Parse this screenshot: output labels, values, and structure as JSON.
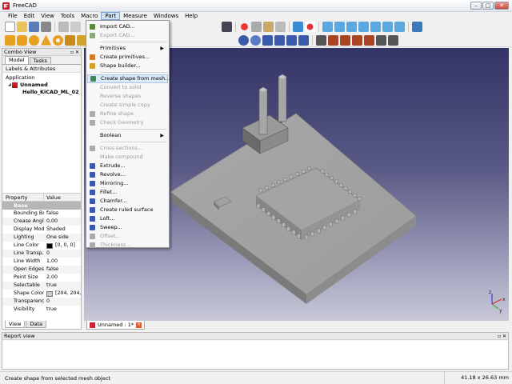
{
  "window": {
    "title": "FreeCAD",
    "min": "–",
    "max": "□",
    "close": "✕"
  },
  "menubar": [
    "File",
    "Edit",
    "View",
    "Tools",
    "Macro",
    "Part",
    "Measure",
    "Windows",
    "Help"
  ],
  "combo_view": {
    "title": "Combo View",
    "tabs": [
      "Model",
      "Tasks"
    ],
    "labels_header": "Labels & Attributes",
    "tree": {
      "root": "Application",
      "document": "Unnamed",
      "object": "Hello_KiCAD_ML_02"
    }
  },
  "property_table": {
    "headers": [
      "Property",
      "Value"
    ],
    "group": "Base",
    "rows": [
      {
        "name": "Bounding Box",
        "value": "false"
      },
      {
        "name": "Crease Angle",
        "value": "0,00"
      },
      {
        "name": "Display Mode",
        "value": "Shaded"
      },
      {
        "name": "Lighting",
        "value": "One side"
      },
      {
        "name": "Line Color",
        "value": "[0, 0, 0]",
        "swatch": "#000000"
      },
      {
        "name": "Line Transp...",
        "value": "0"
      },
      {
        "name": "Line Width",
        "value": "1,00"
      },
      {
        "name": "Open Edges",
        "value": "false"
      },
      {
        "name": "Point Size",
        "value": "2,00"
      },
      {
        "name": "Selectable",
        "value": "true"
      },
      {
        "name": "Shape Color",
        "value": "[204, 204, 2...",
        "swatch": "#cccccc"
      },
      {
        "name": "Transparency",
        "value": "0"
      },
      {
        "name": "Visibility",
        "value": "true"
      }
    ],
    "bottom_tabs": [
      "View",
      "Data"
    ]
  },
  "doc_tab": {
    "label": "Unnamed : 1*"
  },
  "report_view": {
    "title": "Report view"
  },
  "part_menu": [
    {
      "label": "Import CAD...",
      "icon": "import-cad-icon",
      "color": "#5a8a3a"
    },
    {
      "label": "Export CAD...",
      "icon": "export-cad-icon",
      "color": "#8aa878",
      "disabled": true
    },
    {
      "sep": true
    },
    {
      "label": "Primitives",
      "submenu": true
    },
    {
      "label": "Create primitives...",
      "icon": "primitives-icon",
      "color": "#d47a2a"
    },
    {
      "label": "Shape builder...",
      "icon": "shape-builder-icon",
      "color": "#d4a22a"
    },
    {
      "sep": true
    },
    {
      "label": "Create shape from mesh...",
      "icon": "shape-from-mesh-icon",
      "color": "#3a8a5a",
      "highlight": true
    },
    {
      "label": "Convert to solid",
      "disabled": true
    },
    {
      "label": "Reverse shapes",
      "disabled": true
    },
    {
      "label": "Create simple copy",
      "disabled": true
    },
    {
      "label": "Refine shape",
      "icon": "refine-icon",
      "color": "#aaaaaa",
      "disabled": true
    },
    {
      "label": "Check Geometry",
      "icon": "check-geometry-icon",
      "color": "#aaaaaa",
      "disabled": true
    },
    {
      "sep": true
    },
    {
      "label": "Boolean",
      "submenu": true
    },
    {
      "sep": true
    },
    {
      "label": "Cross-sections...",
      "icon": "cross-section-icon",
      "color": "#aaaaaa",
      "disabled": true
    },
    {
      "label": "Make compound",
      "disabled": true
    },
    {
      "label": "Extrude...",
      "icon": "extrude-icon",
      "color": "#3a5aaa"
    },
    {
      "label": "Revolve...",
      "icon": "revolve-icon",
      "color": "#3a5aaa"
    },
    {
      "label": "Mirroring...",
      "icon": "mirror-icon",
      "color": "#3a5aaa"
    },
    {
      "label": "Fillet...",
      "icon": "fillet-icon",
      "color": "#3a5aaa"
    },
    {
      "label": "Chamfer...",
      "icon": "chamfer-icon",
      "color": "#3a5aaa"
    },
    {
      "label": "Create ruled surface",
      "icon": "ruled-surface-icon",
      "color": "#3a5aaa"
    },
    {
      "label": "Loft...",
      "icon": "loft-icon",
      "color": "#3a5aaa"
    },
    {
      "label": "Sweep...",
      "icon": "sweep-icon",
      "color": "#3a5aaa"
    },
    {
      "label": "Offset...",
      "icon": "offset-icon",
      "color": "#aaaaaa",
      "disabled": true
    },
    {
      "label": "Thickness...",
      "icon": "thickness-icon",
      "color": "#aaaaaa",
      "disabled": true
    }
  ],
  "statusbar": {
    "message": "Create shape from selected mesh object",
    "dimensions": "41.18 x 26.63 mm"
  },
  "axis": {
    "x": "x",
    "y": "y",
    "z": "z"
  },
  "colors": {
    "menu_highlight": "#dce9f7",
    "viewport_top": "#333366",
    "viewport_bottom": "#c8c8d8",
    "model": "#9a9a9a"
  }
}
